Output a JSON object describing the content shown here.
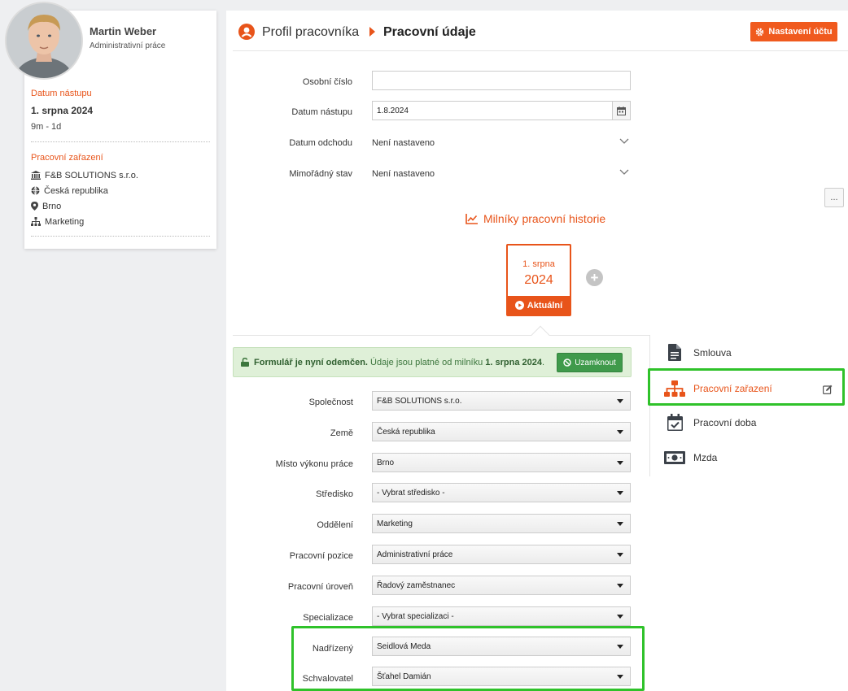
{
  "profile": {
    "name": "Martin Weber",
    "role": "Administrativní práce",
    "start_heading": "Datum nástupu",
    "start_date": "1. srpna 2024",
    "tenure": "9m - 1d",
    "assignment_heading": "Pracovní zařazení",
    "company": "F&B SOLUTIONS s.r.o.",
    "country": "Česká republika",
    "city": "Brno",
    "department": "Marketing"
  },
  "header": {
    "crumb_profile": "Profil pracovníka",
    "crumb_current": "Pracovní údaje",
    "settings_button": "Nastavení účtu"
  },
  "basic_fields": {
    "personal_number_label": "Osobní číslo",
    "personal_number_value": "",
    "start_label": "Datum nástupu",
    "start_value": "1.8.2024",
    "leave_label": "Datum odchodu",
    "leave_value": "Není nastaveno",
    "special_label": "Mimořádný stav",
    "special_value": "Není nastaveno",
    "more_button": "..."
  },
  "milestones": {
    "title": "Milníky pracovní historie",
    "card_day": "1. srpna",
    "card_year": "2024",
    "card_status": "Aktuální",
    "add_label": "+"
  },
  "alert": {
    "bold": "Formulář je nyní odemčen.",
    "text_before": " Údaje jsou platné od milníku ",
    "date": "1. srpna 2024",
    "text_after": ".",
    "lock_button": "Uzamknout"
  },
  "form": {
    "company_label": "Společnost",
    "company_value": "F&B SOLUTIONS s.r.o.",
    "country_label": "Země",
    "country_value": "Česká republika",
    "place_label": "Místo výkonu práce",
    "place_value": "Brno",
    "center_label": "Středisko",
    "center_value": "- Vybrat středisko -",
    "department_label": "Oddělení",
    "department_value": "Marketing",
    "position_label": "Pracovní pozice",
    "position_value": "Administrativní práce",
    "level_label": "Pracovní úroveň",
    "level_value": "Řadový zaměstnanec",
    "specialization_label": "Specializace",
    "specialization_value": "- Vybrat specializaci -",
    "supervisor_label": "Nadřízený",
    "supervisor_value": "Seidlová Meda",
    "approver_label": "Schvalovatel",
    "approver_value": "Šťahel Damián"
  },
  "side_nav": {
    "contract": "Smlouva",
    "assignment": "Pracovní zařazení",
    "work_time": "Pracovní doba",
    "salary": "Mzda"
  },
  "colors": {
    "accent": "#e8541a",
    "success": "#3f9a4b",
    "highlight": "#2fc22a"
  }
}
